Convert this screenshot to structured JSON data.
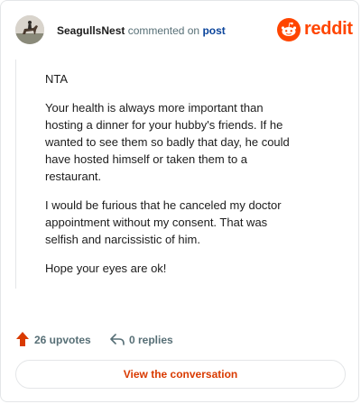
{
  "header": {
    "username": "SeagullsNest",
    "action_text": "commented on",
    "post_link": "post",
    "brand_name": "reddit"
  },
  "comment": {
    "paragraphs": [
      "NTA",
      "Your health is always more important than hosting a dinner for your hubby's friends. If he wanted to see them so badly that day, he could have hosted himself or taken them to a restaurant.",
      "I would be furious that he canceled my doctor appointment without my consent. That was selfish and narcissistic of him.",
      "Hope your eyes are ok!"
    ]
  },
  "stats": {
    "upvotes": "26 upvotes",
    "replies": "0 replies"
  },
  "cta": {
    "label": "View the conversation"
  },
  "colors": {
    "brand": "#ff4500",
    "upvote": "#d93a00",
    "link": "#0a449b",
    "muted": "#576f76"
  },
  "icons": {
    "avatar": "avatar-horse-rider",
    "brand": "reddit-snoo-icon",
    "upvote": "upvote-arrow-icon",
    "reply": "reply-arrow-icon"
  }
}
